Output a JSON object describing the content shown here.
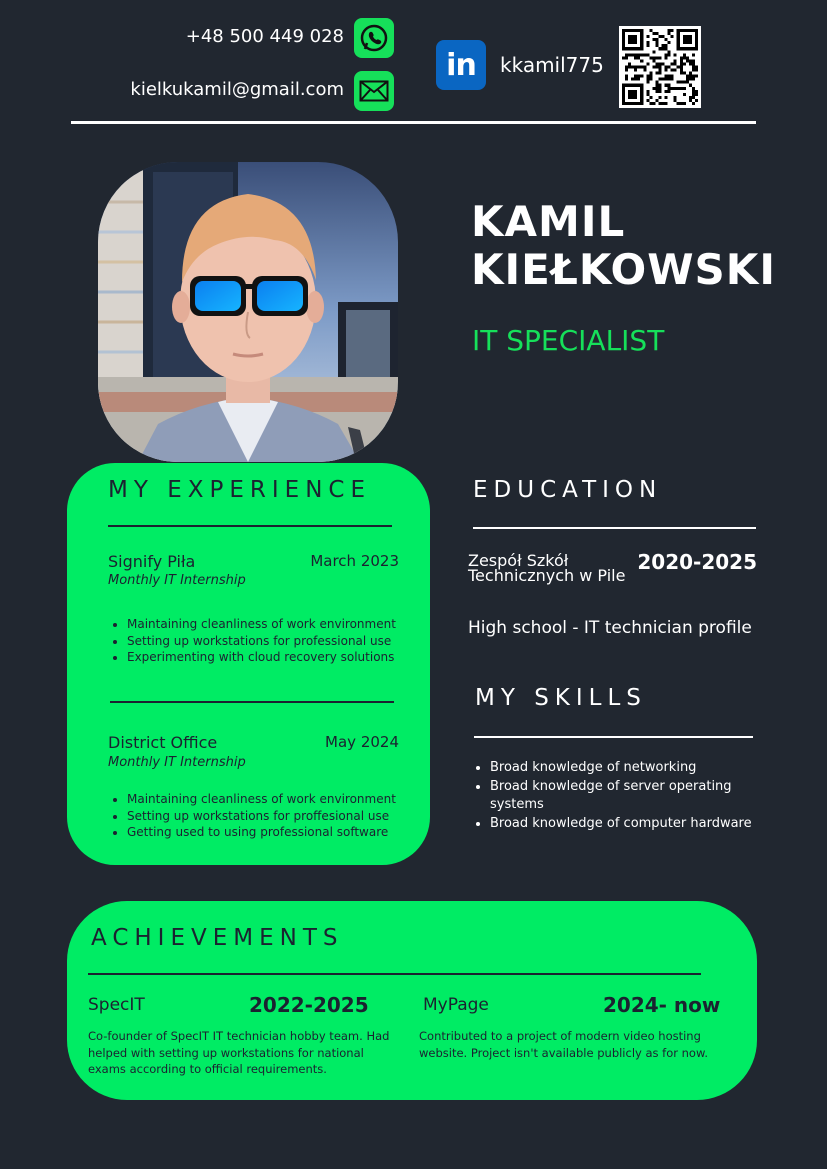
{
  "contact": {
    "phone": "+48 500 449 028",
    "email": "kielkukamil@gmail.com",
    "linkedin_handle": "kkamil775",
    "linkedin_logo_text": "in"
  },
  "profile": {
    "first_name": "KAMIL",
    "last_name": "KIEŁKOWSKI",
    "role": "IT SPECIALIST"
  },
  "experience": {
    "title": "MY EXPERIENCE",
    "jobs": [
      {
        "company": "Signify Piła",
        "date": "March 2023",
        "type": "Monthly IT Internship",
        "tasks": [
          "Maintaining cleanliness of work environment",
          "Setting up workstations for professional use",
          "Experimenting with cloud recovery solutions"
        ]
      },
      {
        "company": "District Office",
        "date": "May 2024",
        "type": "Monthly IT Internship",
        "tasks": [
          "Maintaining cleanliness of work environment",
          "Setting up workstations for proffesional use",
          "Getting used to using professional software"
        ]
      }
    ]
  },
  "education": {
    "title": "EDUCATION",
    "school": "Zespół Szkół Technicznych w Pile",
    "years": "2020-2025",
    "description": "High school - IT technician profile"
  },
  "skills": {
    "title": "MY SKILLS",
    "items": [
      "Broad knowledge of networking",
      "Broad knowledge of server operating systems",
      "Broad knowledge of computer hardware"
    ]
  },
  "achievements": {
    "title": "ACHIEVEMENTS",
    "items": [
      {
        "name": "SpecIT",
        "years": "2022-2025",
        "description": "Co-founder of SpecIT IT technician hobby team. Had helped with setting up workstations for national exams according to official requirements."
      },
      {
        "name": "MyPage",
        "years": "2024- now",
        "description": "Contributed to a project of modern video hosting website. Project isn't available publicly as for now."
      }
    ]
  },
  "colors": {
    "background": "#212730",
    "accent_green": "#00ec64",
    "icon_green": "#16e05a",
    "linkedin_blue": "#0a66c2",
    "panel_text": "#1b2230"
  },
  "icons": {
    "phone": "whatsapp-phone-icon",
    "email": "envelope-icon",
    "linkedin": "linkedin-icon",
    "qr": "qr-code-icon"
  }
}
